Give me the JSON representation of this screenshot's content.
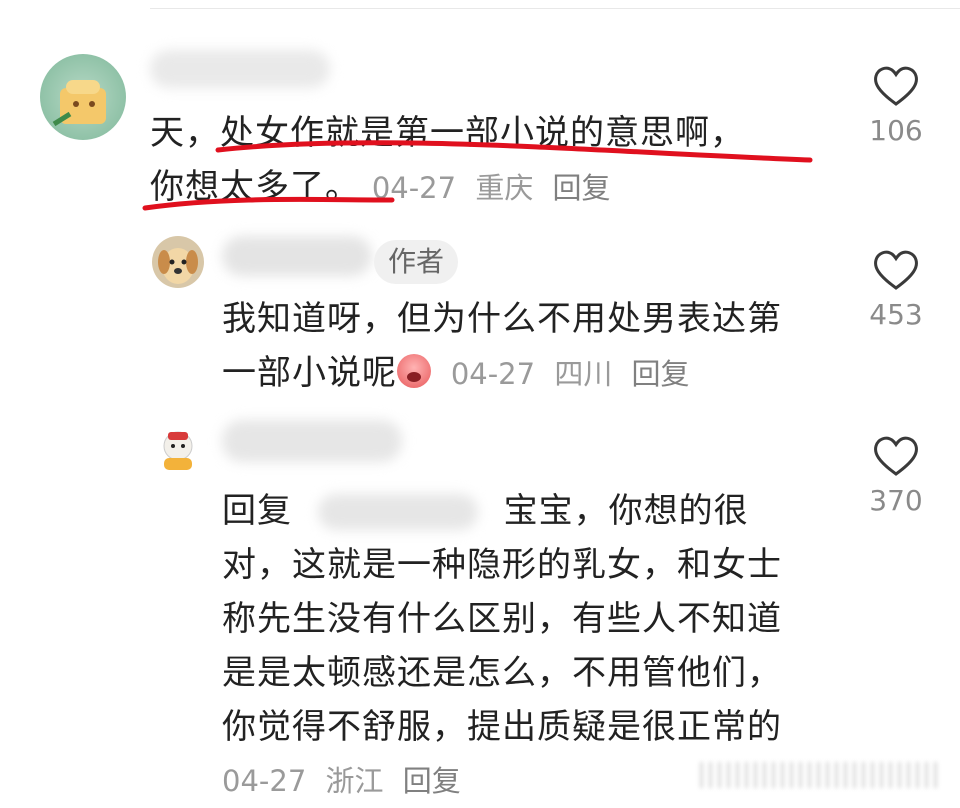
{
  "comments": [
    {
      "text_lines": [
        "天，处女作就是第一部小说的意思啊，",
        "你想太多了。"
      ],
      "date": "04-27",
      "location": "重庆",
      "reply_label": "回复",
      "likes": "106",
      "avatar_icon": "toast-avatar-icon"
    },
    {
      "author_badge": "作者",
      "text_lines": [
        "我知道呀，但为什么不用处男表达第",
        "一部小说呢"
      ],
      "emoji_icon": "crying-face-emoji-icon",
      "date": "04-27",
      "location": "四川",
      "reply_label": "回复",
      "likes": "453",
      "avatar_icon": "puppy-avatar-icon"
    },
    {
      "reply_prefix": "回复",
      "text_first_tail": "宝宝，你想的很",
      "text_lines": [
        "对，这就是一种隐形的乳女，和女士",
        "称先生没有什么区别，有些人不知道",
        "是是太顿感还是怎么，不用管他们，",
        "你觉得不舒服，提出质疑是很正常的"
      ],
      "date": "04-27",
      "location": "浙江",
      "reply_label": "回复",
      "likes": "370",
      "avatar_icon": "cartoon-sheep-avatar-icon"
    }
  ],
  "colors": {
    "underline": "#e0101e",
    "meta": "#9a9a9a",
    "text": "#222222"
  }
}
